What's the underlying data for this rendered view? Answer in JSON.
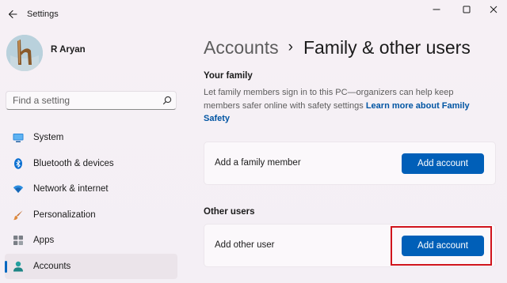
{
  "window": {
    "title": "Settings",
    "back_icon": "back-arrow-icon",
    "controls": [
      "minimize-icon",
      "maximize-icon",
      "close-icon"
    ]
  },
  "profile": {
    "name": "R Aryan",
    "avatar_letter": "h"
  },
  "search": {
    "placeholder": "Find a setting",
    "icon": "search-icon"
  },
  "sidebar": {
    "items": [
      {
        "label": "System",
        "icon": "monitor-icon",
        "active": false
      },
      {
        "label": "Bluetooth & devices",
        "icon": "bluetooth-icon",
        "active": false
      },
      {
        "label": "Network & internet",
        "icon": "wifi-icon",
        "active": false
      },
      {
        "label": "Personalization",
        "icon": "brush-icon",
        "active": false
      },
      {
        "label": "Apps",
        "icon": "apps-icon",
        "active": false
      },
      {
        "label": "Accounts",
        "icon": "person-icon",
        "active": true
      }
    ]
  },
  "main": {
    "breadcrumb": {
      "parent": "Accounts",
      "separator": "›",
      "current": "Family & other users"
    },
    "your_family": {
      "title": "Your family",
      "description": "Let family members sign in to this PC—organizers can help keep members safer online with safety settings",
      "link": "Learn more about Family Safety",
      "card_label": "Add a family member",
      "button": "Add account"
    },
    "other_users": {
      "title": "Other users",
      "card_label": "Add other user",
      "button": "Add account"
    }
  },
  "colors": {
    "accent": "#005fb8",
    "highlight": "#d0141c",
    "background": "#f3eef3"
  }
}
